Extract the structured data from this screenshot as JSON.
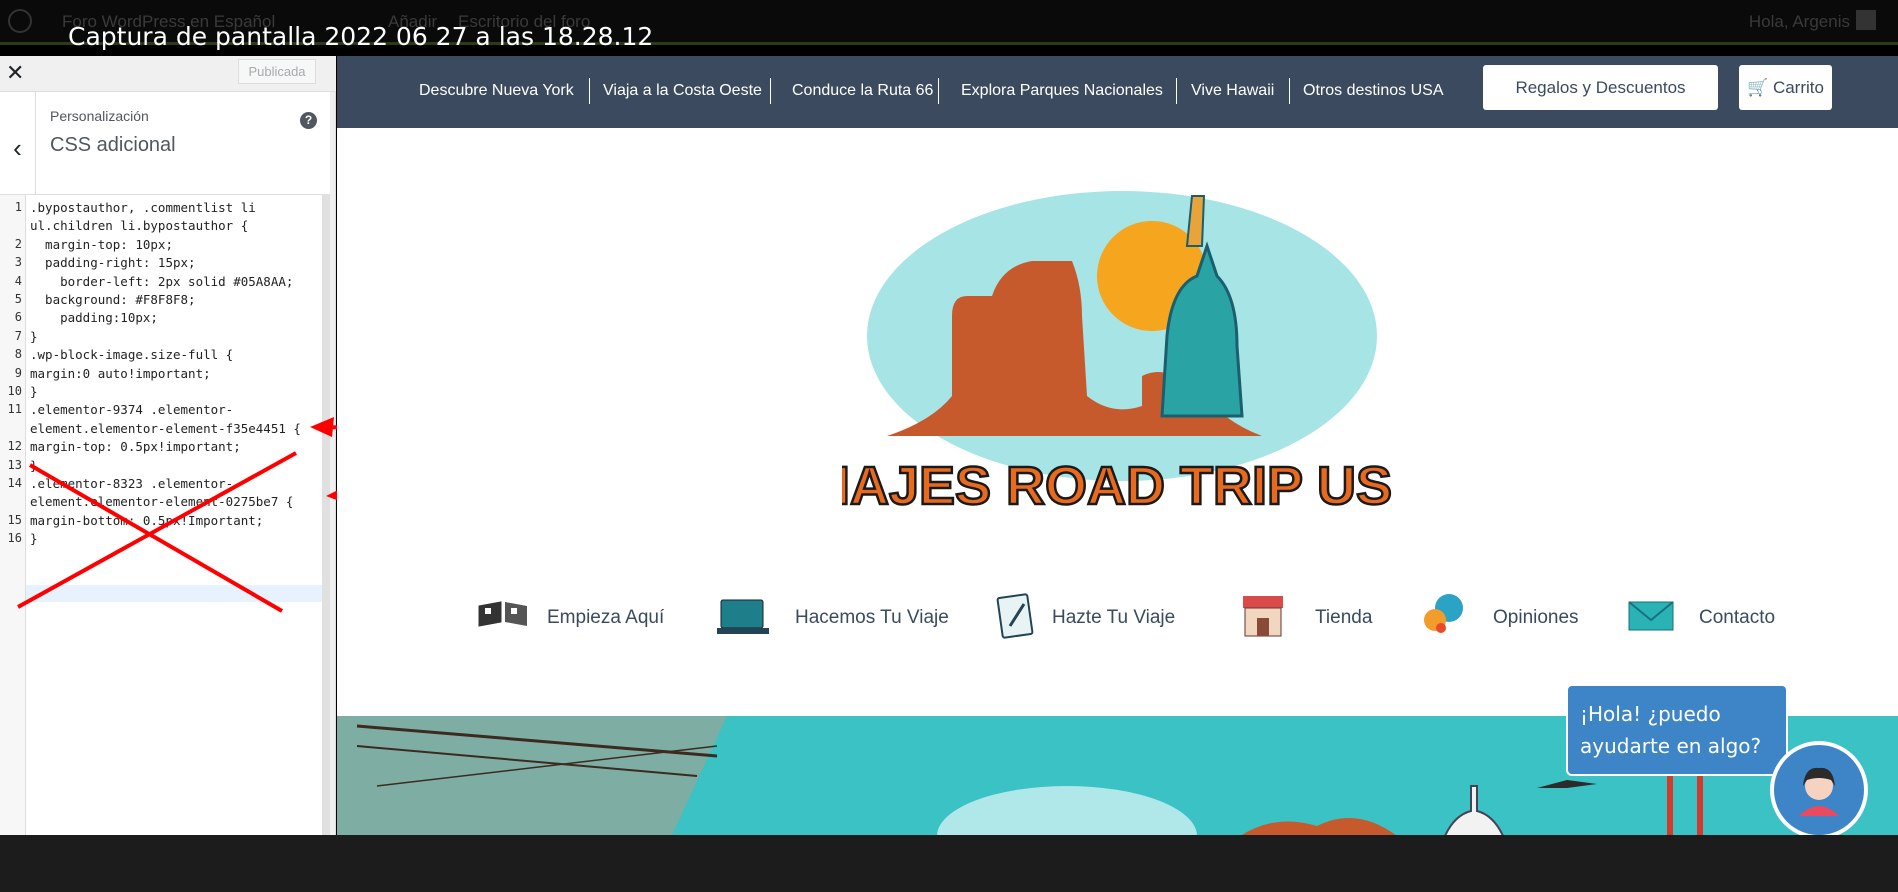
{
  "capture_title": "Captura de pantalla 2022 06 27 a las 18.28.12",
  "adminbar": {
    "items": [
      "Foro WordPress en Español",
      "Añadir",
      "Escritorio del foro"
    ],
    "greeting": "Hola, Argenis"
  },
  "customizer": {
    "close_icon": "close-icon",
    "publish_label": "Publicada",
    "section": "Personalización",
    "title": "CSS adicional",
    "help_label": "?",
    "lines": [
      {
        "n": "1",
        "text": ".bypostauthor, .commentlist li"
      },
      {
        "n": "",
        "text": "ul.children li.bypostauthor {"
      },
      {
        "n": "2",
        "text": "  margin-top: 10px;"
      },
      {
        "n": "3",
        "text": "  padding-right: 15px;"
      },
      {
        "n": "4",
        "text": "    border-left: 2px solid #05A8AA;"
      },
      {
        "n": "5",
        "text": "  background: #F8F8F8;"
      },
      {
        "n": "6",
        "text": "    padding:10px;"
      },
      {
        "n": "7",
        "text": "}"
      },
      {
        "n": "8",
        "text": ".wp-block-image.size-full {"
      },
      {
        "n": "9",
        "text": "margin:0 auto!important;"
      },
      {
        "n": "10",
        "text": "}"
      },
      {
        "n": "11",
        "text": ".elementor-9374 .elementor-"
      },
      {
        "n": "",
        "text": "element.elementor-element-f35e4451 {"
      },
      {
        "n": "12",
        "text": "margin-top: 0.5px!important;"
      },
      {
        "n": "13",
        "text": "}"
      },
      {
        "n": "14",
        "text": ".elementor-8323 .elementor-"
      },
      {
        "n": "",
        "text": "element.elementor-element-0275be7 {"
      },
      {
        "n": "15",
        "text": "margin-bottom: 0.5px!Important;"
      },
      {
        "n": "16",
        "text": "}"
      }
    ]
  },
  "site": {
    "nav": [
      "Descubre Nueva York",
      "Viaja a la Costa Oeste",
      "Conduce la Ruta 66",
      "Explora Parques Nacionales",
      "Vive Hawaii",
      "Otros destinos USA"
    ],
    "promo_button": "Regalos y Descuentos",
    "cart_button": "Carrito",
    "logo_text": "VIAJES ROAD TRIP USA",
    "icon_menu": [
      {
        "label": "Empieza Aquí",
        "icon": "checkered-flags-icon"
      },
      {
        "label": "Hacemos Tu Viaje",
        "icon": "laptop-icon"
      },
      {
        "label": "Hazte Tu Viaje",
        "icon": "notepad-icon"
      },
      {
        "label": "Tienda",
        "icon": "shop-icon"
      },
      {
        "label": "Opiniones",
        "icon": "speech-bubbles-icon"
      },
      {
        "label": "Contacto",
        "icon": "envelope-icon"
      }
    ]
  },
  "chat": {
    "message": "¡Hola! ¿puedo ayudarte en algo?"
  },
  "colors": {
    "nav_bg": "#3b4a5e",
    "chat_blue": "#3d85c6",
    "annotation_red": "#ff0000",
    "banner_teal": "#3ac2c5"
  }
}
